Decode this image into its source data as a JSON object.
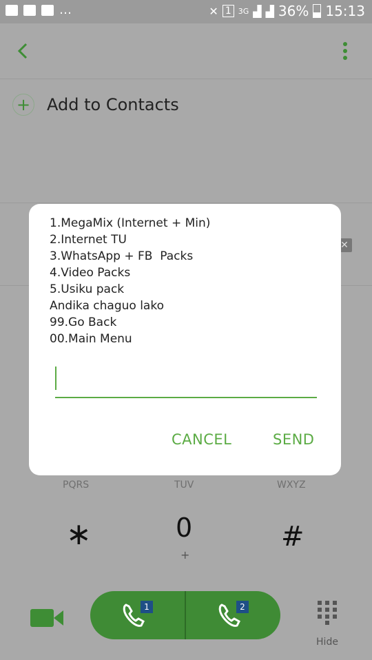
{
  "status": {
    "battery": "36%",
    "time": "15:13",
    "network": "3G",
    "sim_indicator": "1"
  },
  "contact": {
    "add_label": "Add to Contacts"
  },
  "dialog": {
    "lines": [
      "1.MegaMix (Internet + Min)",
      "2.Internet TU",
      "3.WhatsApp + FB  Packs",
      "4.Video Packs",
      "5.Usiku pack",
      "Andika chaguo lako",
      "99.Go Back",
      "00.Main Menu"
    ],
    "input_value": "",
    "cancel": "CANCEL",
    "send": "SEND"
  },
  "keypad": {
    "letters": [
      "PQRS",
      "TUV",
      "WXYZ"
    ],
    "star": "∗",
    "zero": "0",
    "plus": "+",
    "hash": "#"
  },
  "dock": {
    "sim1": "1",
    "sim2": "2",
    "hide": "Hide"
  },
  "colors": {
    "accent": "#5bab44",
    "call_green": "#3f8b35",
    "overlay": "#a9a9a9"
  },
  "icons": [
    "back-arrow-icon",
    "more-vert-icon",
    "add-icon",
    "video-call-icon",
    "phone-icon",
    "keypad-icon"
  ]
}
